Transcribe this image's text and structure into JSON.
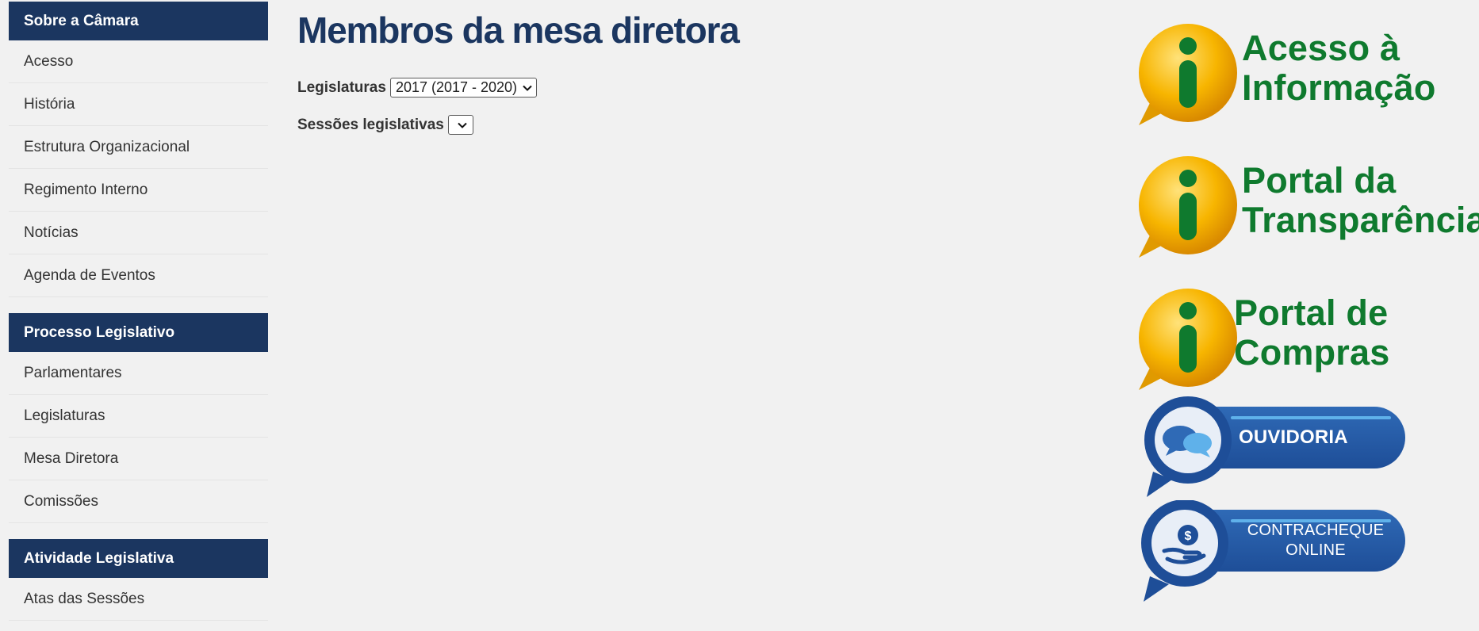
{
  "sidebar": {
    "sections": [
      {
        "header": "Sobre a Câmara",
        "items": [
          "Acesso",
          "História",
          "Estrutura Organizacional",
          "Regimento Interno",
          "Notícias",
          "Agenda de Eventos"
        ]
      },
      {
        "header": "Processo Legislativo",
        "items": [
          "Parlamentares",
          "Legislaturas",
          "Mesa Diretora",
          "Comissões"
        ]
      },
      {
        "header": "Atividade Legislativa",
        "items": [
          "Atas das Sessões"
        ]
      }
    ]
  },
  "main": {
    "title": "Membros da mesa diretora",
    "legislaturas_label": "Legislaturas",
    "legislaturas_selected": "2017 (2017 - 2020)",
    "sessoes_label": "Sessões legislativas",
    "sessoes_selected": ""
  },
  "banners": {
    "acesso": {
      "line1": "Acesso à",
      "line2": "Informação"
    },
    "transparencia": {
      "line1": "Portal da",
      "line2": "Transparência"
    },
    "compras": {
      "line1": "Portal de",
      "line2": "Compras"
    },
    "ouvidoria": {
      "label": "OUVIDORIA"
    },
    "contracheque": {
      "line1": "CONTRACHEQUE",
      "line2": "ONLINE"
    }
  },
  "colors": {
    "sidebar_header": "#1b3660",
    "title": "#1b3660",
    "info_green": "#0f7a2e",
    "info_yellow": "#f6b800",
    "pill_blue": "#1e4e98"
  },
  "icons": {
    "info": "info-icon",
    "chevron": "chevron-down-icon",
    "chat": "chat-bubbles-icon",
    "money": "money-hand-icon"
  }
}
